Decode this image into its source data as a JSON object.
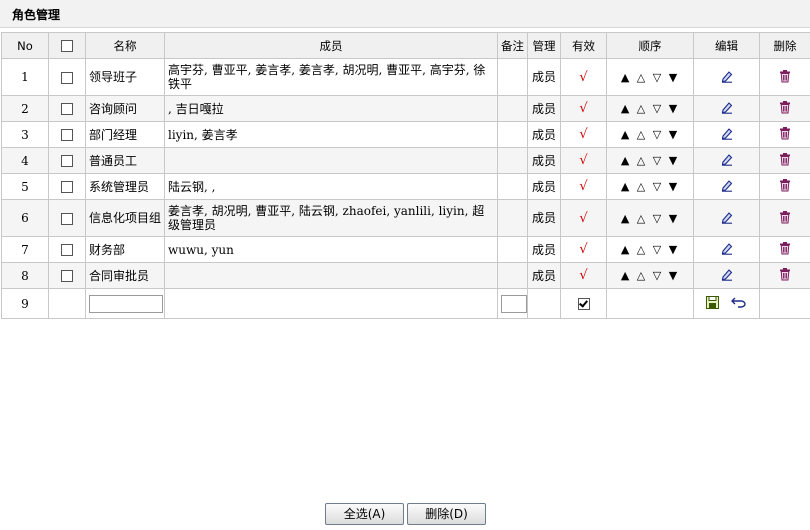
{
  "header": {
    "title": "角色管理"
  },
  "columns": {
    "no": "No",
    "name": "名称",
    "members": "成员",
    "remark": "备注",
    "manage": "管理",
    "valid": "有效",
    "order": "顺序",
    "edit": "编辑",
    "delete": "删除"
  },
  "valid_mark": "√",
  "order_arrows": [
    "▲",
    "△",
    "▽",
    "▼"
  ],
  "rows": [
    {
      "no": "1",
      "name": "领导班子",
      "members": "高宇芬, 曹亚平, 姜言孝, 姜言孝, 胡况明, 曹亚平, 高宇芬, 徐铁平",
      "remark": "",
      "manage": "成员"
    },
    {
      "no": "2",
      "name": "咨询顾问",
      "members": ", 吉日嘎拉",
      "remark": "",
      "manage": "成员"
    },
    {
      "no": "3",
      "name": "部门经理",
      "members": "liyin, 姜言孝",
      "remark": "",
      "manage": "成员"
    },
    {
      "no": "4",
      "name": "普通员工",
      "members": "",
      "remark": "",
      "manage": "成员"
    },
    {
      "no": "5",
      "name": "系统管理员",
      "members": "陆云钢, ,",
      "remark": "",
      "manage": "成员"
    },
    {
      "no": "6",
      "name": "信息化项目组",
      "members": "姜言孝, 胡况明, 曹亚平, 陆云钢, zhaofei, yanlili, liyin, 超级管理员",
      "remark": "",
      "manage": "成员"
    },
    {
      "no": "7",
      "name": "财务部",
      "members": "wuwu, yun",
      "remark": "",
      "manage": "成员"
    },
    {
      "no": "8",
      "name": "合同审批员",
      "members": "",
      "remark": "",
      "manage": "成员"
    }
  ],
  "new_row": {
    "no": "9",
    "name_value": "",
    "remark_value": "",
    "valid_checked": true
  },
  "buttons": {
    "select_all": "全选(A)",
    "delete": "删除(D)"
  }
}
